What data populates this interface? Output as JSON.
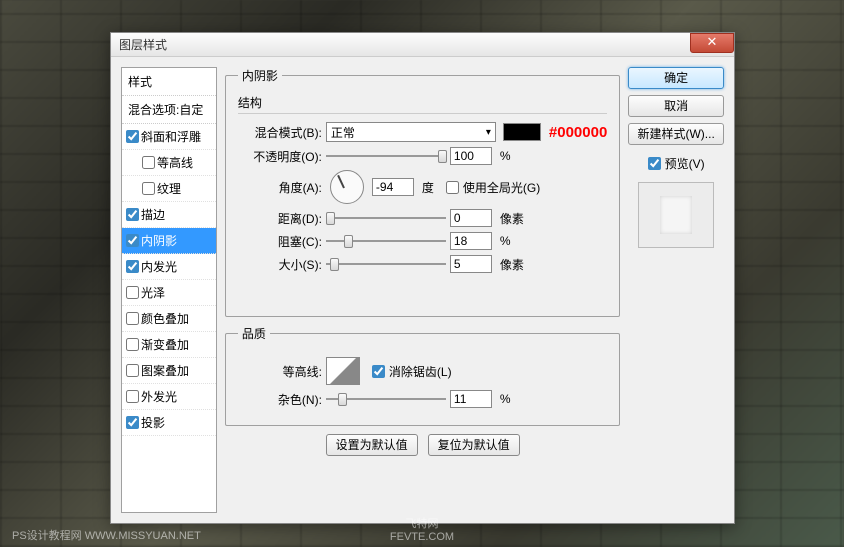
{
  "dialog": {
    "title": "图层样式"
  },
  "sidebar": {
    "styles_header": "样式",
    "blend_header": "混合选项:自定",
    "items": [
      {
        "label": "斜面和浮雕",
        "checked": true,
        "sub": false
      },
      {
        "label": "等高线",
        "checked": false,
        "sub": true
      },
      {
        "label": "纹理",
        "checked": false,
        "sub": true
      },
      {
        "label": "描边",
        "checked": true,
        "sub": false
      },
      {
        "label": "内阴影",
        "checked": true,
        "sub": false,
        "selected": true
      },
      {
        "label": "内发光",
        "checked": true,
        "sub": false
      },
      {
        "label": "光泽",
        "checked": false,
        "sub": false
      },
      {
        "label": "颜色叠加",
        "checked": false,
        "sub": false
      },
      {
        "label": "渐变叠加",
        "checked": false,
        "sub": false
      },
      {
        "label": "图案叠加",
        "checked": false,
        "sub": false
      },
      {
        "label": "外发光",
        "checked": false,
        "sub": false
      },
      {
        "label": "投影",
        "checked": true,
        "sub": false
      }
    ]
  },
  "panel": {
    "title": "内阴影",
    "structure": {
      "legend": "结构",
      "blend_mode_label": "混合模式(B):",
      "blend_mode_value": "正常",
      "color_hex": "#000000",
      "opacity_label": "不透明度(O):",
      "opacity_value": "100",
      "opacity_unit": "%",
      "angle_label": "角度(A):",
      "angle_value": "-94",
      "angle_unit": "度",
      "global_light_label": "使用全局光(G)",
      "distance_label": "距离(D):",
      "distance_value": "0",
      "distance_unit": "像素",
      "choke_label": "阻塞(C):",
      "choke_value": "18",
      "choke_unit": "%",
      "size_label": "大小(S):",
      "size_value": "5",
      "size_unit": "像素"
    },
    "quality": {
      "legend": "品质",
      "contour_label": "等高线:",
      "antialias_label": "消除锯齿(L)",
      "noise_label": "杂色(N):",
      "noise_value": "11",
      "noise_unit": "%"
    },
    "default_btn": "设置为默认值",
    "reset_btn": "复位为默认值"
  },
  "right": {
    "ok": "确定",
    "cancel": "取消",
    "new_style": "新建样式(W)...",
    "preview": "预览(V)"
  },
  "watermarks": {
    "left": "PS设计教程网  WWW.MISSYUAN.NET",
    "center_top": "飞特网",
    "center": "FEVTE.COM"
  }
}
